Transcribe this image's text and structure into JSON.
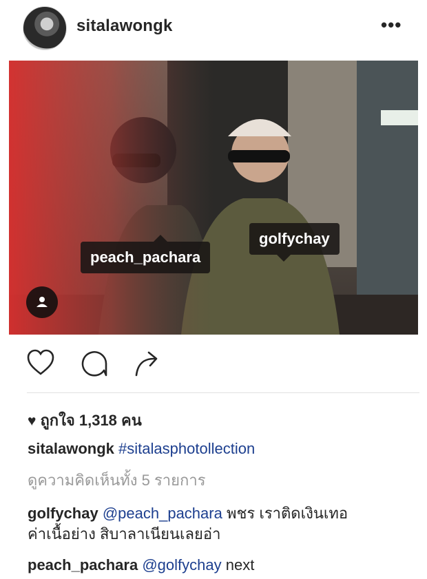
{
  "post": {
    "username": "sitalawongk",
    "more_icon": "more-horizontal-icon",
    "photo_tags": [
      {
        "label": "peach_pachara"
      },
      {
        "label": "golfychay"
      }
    ],
    "actions": [
      "heart-icon",
      "comment-icon",
      "share-icon"
    ],
    "likes": "ถูกใจ 1,318 คน",
    "caption": {
      "user": "sitalawongk",
      "text": "#sitalasphotollection"
    },
    "view_comments": "ดูความคิดเห็นทั้ง 5 รายการ",
    "comments": [
      {
        "user": "golfychay",
        "mention": "@peach_pachara",
        "text_line1": "พชร เราติดเงินเทอ",
        "text_line2": "ค่าเนื้อย่าง สิบาลาเนียนเลยอ่า"
      },
      {
        "user": "peach_pachara",
        "mention": "@golfychay",
        "text": "next"
      }
    ]
  },
  "colors": {
    "mention": "#1d3f8f",
    "muted": "#999999",
    "text": "#262626"
  }
}
